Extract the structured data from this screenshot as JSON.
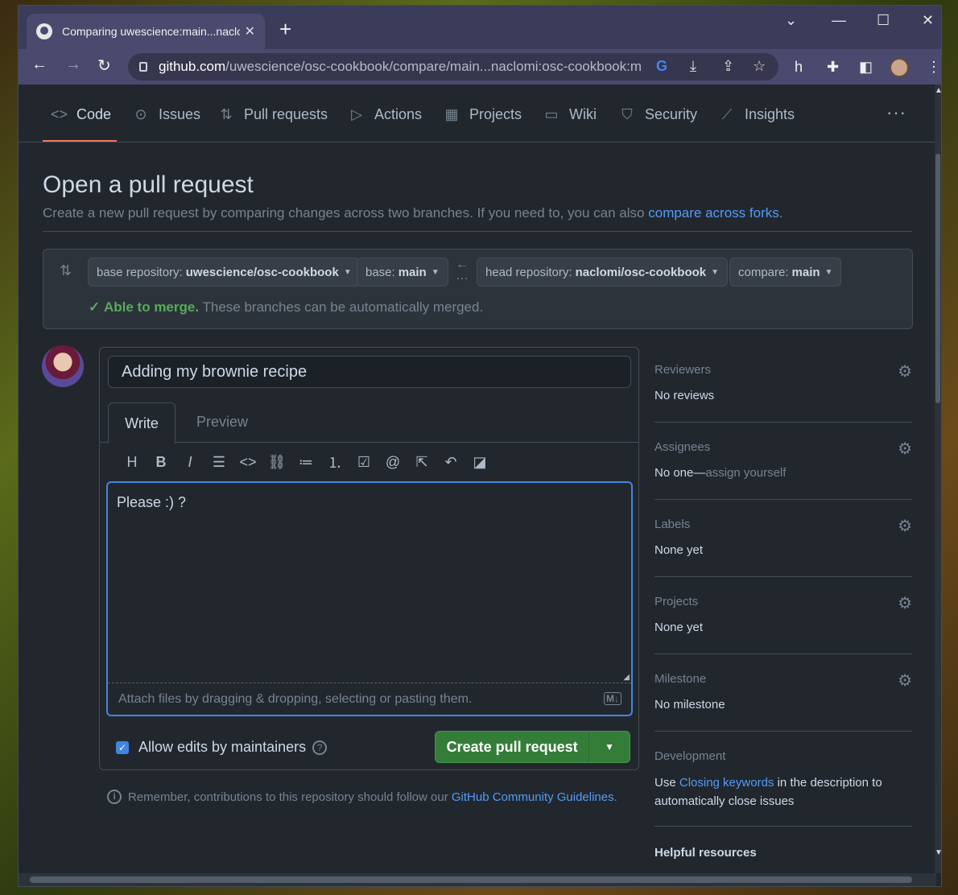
{
  "browser": {
    "tab_title": "Comparing uwescience:main...naclomi:osc-cookbook:main",
    "url_domain": "github.com",
    "url_path": "/uwescience/osc-cookbook/compare/main...naclomi:osc-cookbook:main"
  },
  "repo_nav": [
    {
      "icon": "code-icon",
      "glyph": "<>",
      "label": "Code"
    },
    {
      "icon": "issues-icon",
      "glyph": "⊙",
      "label": "Issues"
    },
    {
      "icon": "pull-request-icon",
      "glyph": "⇅",
      "label": "Pull requests"
    },
    {
      "icon": "actions-icon",
      "glyph": "▷",
      "label": "Actions"
    },
    {
      "icon": "projects-icon",
      "glyph": "▦",
      "label": "Projects"
    },
    {
      "icon": "wiki-icon",
      "glyph": "▭",
      "label": "Wiki"
    },
    {
      "icon": "security-icon",
      "glyph": "⛉",
      "label": "Security"
    },
    {
      "icon": "insights-icon",
      "glyph": "⟋",
      "label": "Insights"
    }
  ],
  "header": {
    "title": "Open a pull request",
    "subtitle": "Create a new pull request by comparing changes across two branches. If you need to, you can also",
    "subtitle_link": "compare across forks",
    "subtitle_end": "."
  },
  "compare": {
    "base_repo_label": "base repository:",
    "base_repo_value": "uwescience/osc-cookbook",
    "base_label": "base:",
    "base_value": "main",
    "head_repo_label": "head repository:",
    "head_repo_value": "naclomi/osc-cookbook",
    "compare_label": "compare:",
    "compare_value": "main",
    "merge_ok": "Able to merge.",
    "merge_text": "These branches can be automatically merged."
  },
  "form": {
    "title_value": "Adding my brownie recipe",
    "tab_write": "Write",
    "tab_preview": "Preview",
    "body_value": "Please :) ?",
    "attach_text": "Attach files by dragging & dropping, selecting or pasting them.",
    "allow_edits": "Allow edits by maintainers",
    "create_button": "Create pull request"
  },
  "note": {
    "text": "Remember, contributions to this repository should follow our",
    "link": "GitHub Community Guidelines",
    "end": "."
  },
  "sidebar": {
    "reviewers": {
      "head": "Reviewers",
      "value": "No reviews"
    },
    "assignees": {
      "head": "Assignees",
      "value": "No one—",
      "value_muted": "assign yourself"
    },
    "labels": {
      "head": "Labels",
      "value": "None yet"
    },
    "projects": {
      "head": "Projects",
      "value": "None yet"
    },
    "milestone": {
      "head": "Milestone",
      "value": "No milestone"
    },
    "development": {
      "head": "Development",
      "text_before": "Use",
      "link": "Closing keywords",
      "text_after": "in the description to automatically close issues"
    },
    "helpful": "Helpful resources"
  }
}
